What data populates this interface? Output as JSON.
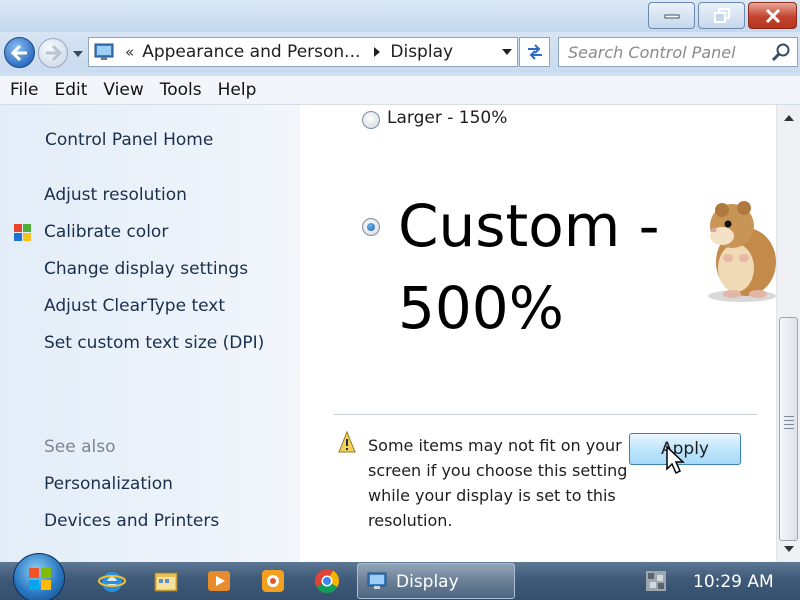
{
  "window": {
    "buttons": [
      "minimize-icon",
      "restore-icon",
      "close-icon"
    ]
  },
  "address": {
    "overflow_marker": "«",
    "crumbs": [
      "Appearance and Person...",
      "Display"
    ]
  },
  "search": {
    "placeholder": "Search Control Panel"
  },
  "menu": [
    "File",
    "Edit",
    "View",
    "Tools",
    "Help"
  ],
  "sidebar": {
    "home": "Control Panel Home",
    "tasks": [
      "Adjust resolution",
      "Calibrate color",
      "Change display settings",
      "Adjust ClearType text",
      "Set custom text size (DPI)"
    ],
    "see_also_heading": "See also",
    "see_also": [
      "Personalization",
      "Devices and Printers"
    ]
  },
  "main": {
    "options": [
      {
        "label": "Larger - 150%",
        "checked": false
      },
      {
        "label": "Custom - 500%",
        "checked": true
      }
    ],
    "warning": "Some items may not fit on your screen if you choose this setting while your display is set to this resolution.",
    "apply_label": "Apply"
  },
  "taskbar": {
    "pinned": [
      "internet-explorer-icon",
      "windows-explorer-icon",
      "media-player-icon",
      "app-icon",
      "chrome-icon"
    ],
    "active_window": "Display",
    "clock": "10:29 AM"
  },
  "colors": {
    "accent": "#2f6fc2",
    "link": "#1a2f4b",
    "muted": "#7a8594"
  }
}
